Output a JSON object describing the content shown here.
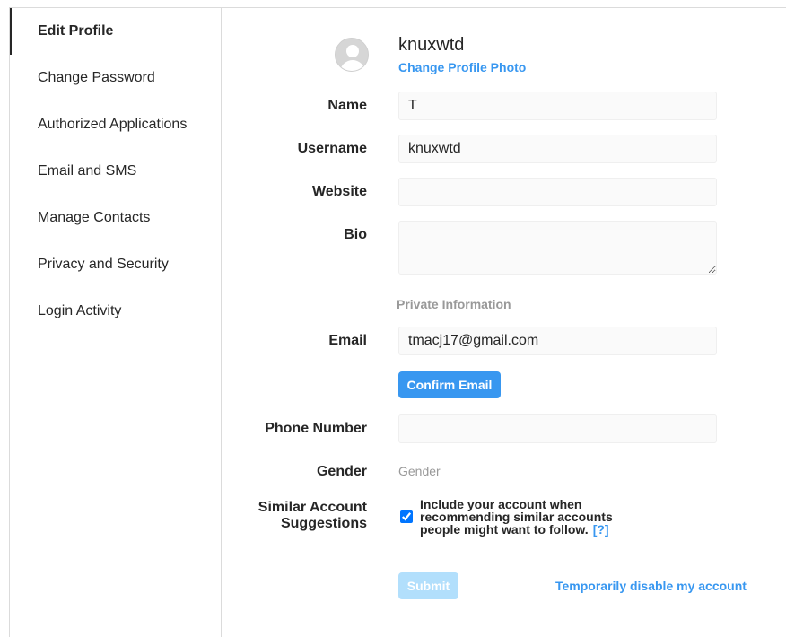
{
  "sidebar": {
    "items": [
      {
        "label": "Edit Profile"
      },
      {
        "label": "Change Password"
      },
      {
        "label": "Authorized Applications"
      },
      {
        "label": "Email and SMS"
      },
      {
        "label": "Manage Contacts"
      },
      {
        "label": "Privacy and Security"
      },
      {
        "label": "Login Activity"
      }
    ]
  },
  "profile": {
    "username": "knuxwtd",
    "change_photo_label": "Change Profile Photo"
  },
  "form": {
    "name": {
      "label": "Name",
      "value": "T"
    },
    "username": {
      "label": "Username",
      "value": "knuxwtd"
    },
    "website": {
      "label": "Website",
      "value": ""
    },
    "bio": {
      "label": "Bio",
      "value": ""
    },
    "private_info_heading": "Private Information",
    "email": {
      "label": "Email",
      "value": "tmacj17@gmail.com"
    },
    "confirm_email_label": "Confirm Email",
    "phone": {
      "label": "Phone Number",
      "value": ""
    },
    "gender": {
      "label": "Gender",
      "value": "Gender"
    },
    "similar": {
      "label_line1": "Similar Account",
      "label_line2": "Suggestions",
      "checked": true,
      "text": "Include your account when recommending similar accounts people might want to follow.",
      "help_link": "[?]"
    },
    "submit_label": "Submit",
    "disable_label": "Temporarily disable my account"
  },
  "colors": {
    "accent": "#3897f0",
    "submit_disabled": "#b2dffc",
    "muted": "#999999",
    "text": "#262626"
  }
}
